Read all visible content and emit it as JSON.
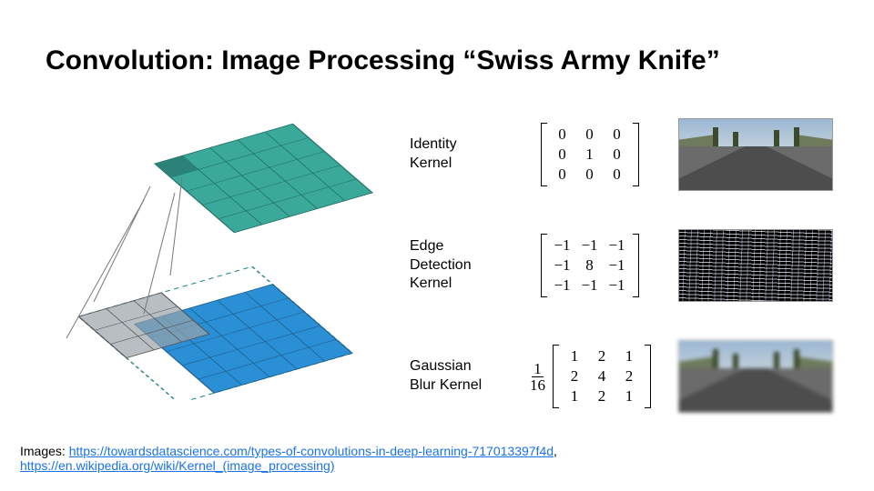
{
  "title": "Convolution: Image Processing “Swiss Army Knife”",
  "kernels": [
    {
      "label": "Identity\nKernel",
      "scalar_num": "",
      "scalar_den": "",
      "m": [
        "0",
        "0",
        "0",
        "0",
        "1",
        "0",
        "0",
        "0",
        "0"
      ]
    },
    {
      "label": "Edge\nDetection\nKernel",
      "scalar_num": "",
      "scalar_den": "",
      "m": [
        "−1",
        "−1",
        "−1",
        "−1",
        "8",
        "−1",
        "−1",
        "−1",
        "−1"
      ]
    },
    {
      "label": "Gaussian\nBlur Kernel",
      "scalar_num": "1",
      "scalar_den": "16",
      "m": [
        "1",
        "2",
        "1",
        "2",
        "4",
        "2",
        "1",
        "2",
        "1"
      ]
    }
  ],
  "footer": {
    "prefix": "Images: ",
    "link1_text": "https://towardsdatascience.com/types-of-convolutions-in-deep-learning-717013397f4d",
    "sep": ", ",
    "link2_text": "https://en.wikipedia.org/wiki/Kernel_(image_processing)"
  }
}
